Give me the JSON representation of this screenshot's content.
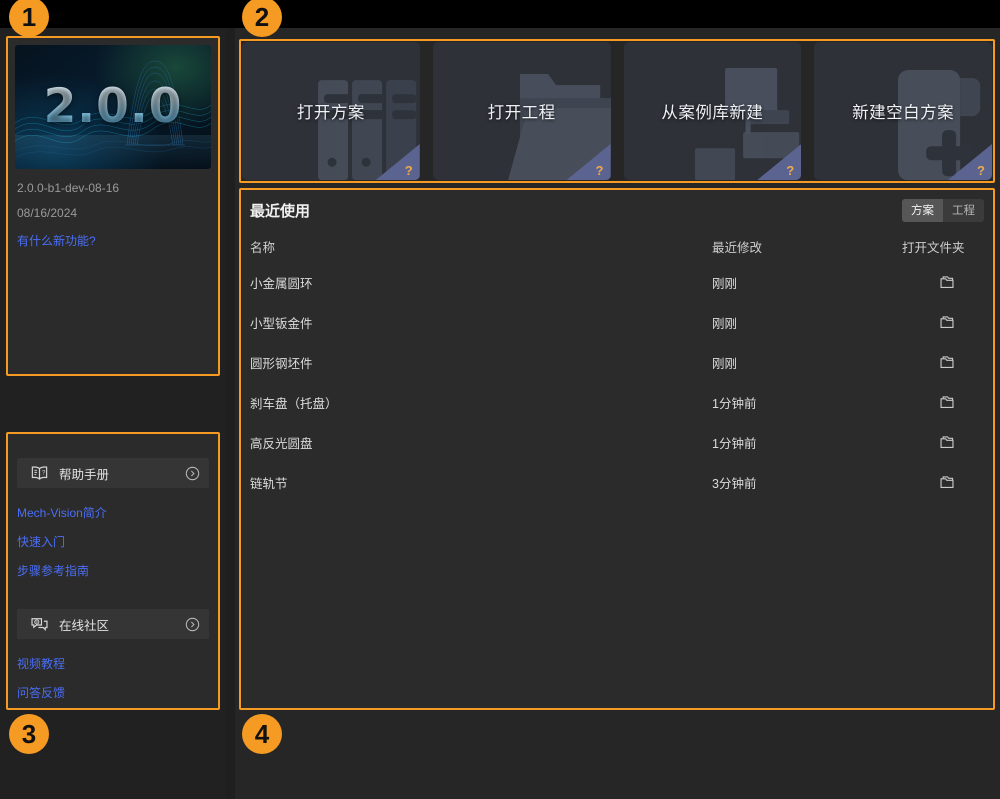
{
  "app": {
    "product": "Mech-Vision",
    "theme": {
      "accent": "#f59a23",
      "link": "#4a6ef5",
      "panel_bg": "#2b2b2b",
      "card_bg": "#2e3138",
      "app_bg": "#262626"
    }
  },
  "annotations": [
    {
      "id": "1",
      "label": "1",
      "target": "version-panel"
    },
    {
      "id": "2",
      "label": "2",
      "target": "action-cards-row"
    },
    {
      "id": "3",
      "label": "3",
      "target": "help-panel"
    },
    {
      "id": "4",
      "label": "4",
      "target": "recent-panel"
    }
  ],
  "version_panel": {
    "banner_version": "2.0.0",
    "build": "2.0.0-b1-dev-08-16",
    "date": "08/16/2024",
    "whats_new_link": "有什么新功能?"
  },
  "help_panel": {
    "sections": [
      {
        "icon": "book-question-icon",
        "title": "帮助手册",
        "arrow_icon": "chevron-right-circle-icon",
        "links": [
          {
            "label": "Mech-Vision简介"
          },
          {
            "label": "快速入门"
          },
          {
            "label": "步骤参考指南"
          }
        ]
      },
      {
        "icon": "chat-bubble-icon",
        "title": "在线社区",
        "arrow_icon": "chevron-right-circle-icon",
        "links": [
          {
            "label": "视频教程"
          },
          {
            "label": "问答反馈"
          }
        ]
      }
    ]
  },
  "action_cards": [
    {
      "label": "打开方案",
      "art": "server-racks-art",
      "corner_badge": "?"
    },
    {
      "label": "打开工程",
      "art": "folder-art",
      "corner_badge": "?"
    },
    {
      "label": "从案例库新建",
      "art": "tree-hierarchy-art",
      "corner_badge": "?"
    },
    {
      "label": "新建空白方案",
      "art": "document-plus-art",
      "corner_badge": "?"
    }
  ],
  "recent": {
    "title": "最近使用",
    "tabs": [
      {
        "label": "方案",
        "active": true
      },
      {
        "label": "工程",
        "active": false
      }
    ],
    "columns": {
      "name": "名称",
      "modified": "最近修改",
      "open_folder": "打开文件夹"
    },
    "rows": [
      {
        "name": "小金属圆环",
        "modified": "刚刚",
        "open_icon": "folder-icon"
      },
      {
        "name": "小型钣金件",
        "modified": "刚刚",
        "open_icon": "folder-icon"
      },
      {
        "name": "圆形钢坯件",
        "modified": "刚刚",
        "open_icon": "folder-icon"
      },
      {
        "name": "刹车盘（托盘）",
        "modified": "1分钟前",
        "open_icon": "folder-icon"
      },
      {
        "name": "高反光圆盘",
        "modified": "1分钟前",
        "open_icon": "folder-icon"
      },
      {
        "name": "链轨节",
        "modified": "3分钟前",
        "open_icon": "folder-icon"
      }
    ]
  }
}
